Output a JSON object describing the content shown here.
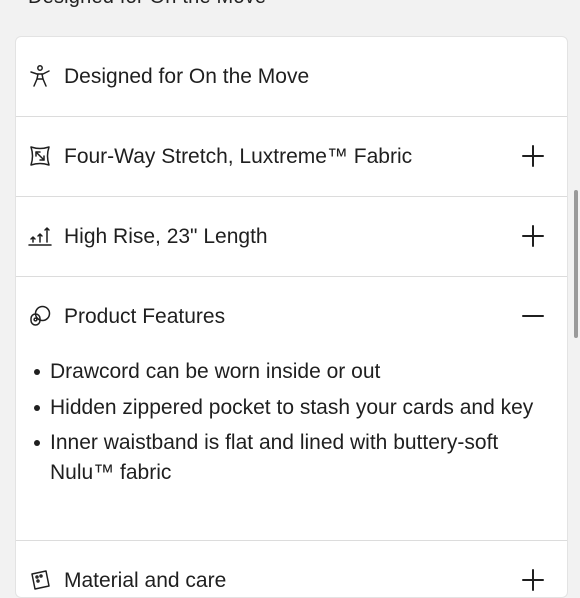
{
  "top_fragment": "Designed for On the Move",
  "accordion": [
    {
      "label": "Designed for On the Move",
      "icon": "person-activity-icon",
      "toggle": "none"
    },
    {
      "label": "Four-Way Stretch, Luxtreme™ Fabric",
      "icon": "stretch-fabric-icon",
      "toggle": "plus"
    },
    {
      "label": "High Rise, 23\" Length",
      "icon": "rise-arrows-icon",
      "toggle": "plus"
    },
    {
      "label": "Product Features",
      "icon": "product-features-icon",
      "toggle": "minus",
      "items": [
        "Drawcord can be worn inside or out",
        "Hidden zippered pocket to stash your cards and key",
        "Inner waistband is flat and lined with buttery-soft Nulu™ fabric"
      ]
    },
    {
      "label": "Material and care",
      "icon": "care-tag-icon",
      "toggle": "plus"
    }
  ],
  "colors": {
    "text": "#1f1f1f",
    "divider": "#dcdcdc",
    "background": "#f2f2f2",
    "card": "#ffffff"
  }
}
